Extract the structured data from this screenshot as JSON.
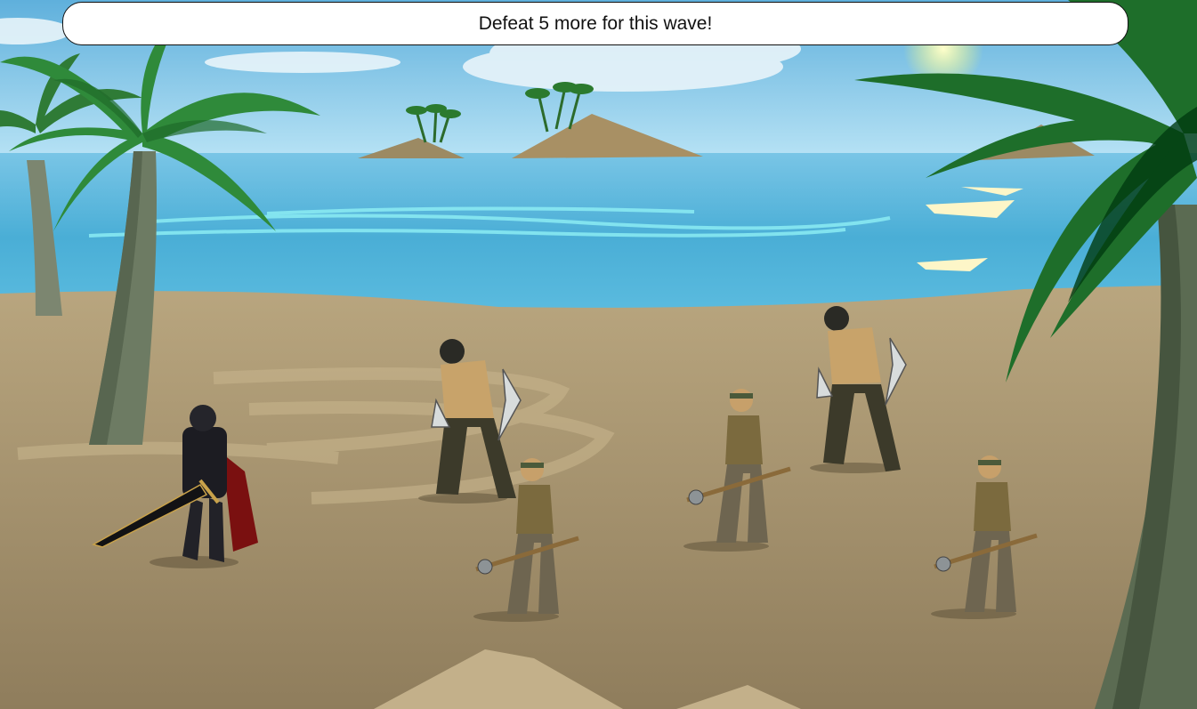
{
  "hud": {
    "wave_message": "Defeat 5 more for this wave!"
  },
  "scene": {
    "location": "beach",
    "colors": {
      "sky": "#8fd0ee",
      "sea": "#4fb3d9",
      "sand": "#a89672",
      "palm_leaf": "#2f8a3a",
      "trunk": "#6b7a5f"
    }
  },
  "characters": {
    "player": {
      "type": "dark-armored-knight",
      "weapon": "greatsword"
    },
    "enemies": [
      {
        "type": "masked-bandit-brawler",
        "weapon": "axe-blade"
      },
      {
        "type": "masked-bandit-brawler",
        "weapon": "axe-blade"
      },
      {
        "type": "bandana-mercenary",
        "weapon": "spiked-mace"
      },
      {
        "type": "bandana-mercenary",
        "weapon": "spiked-mace"
      },
      {
        "type": "bandana-mercenary",
        "weapon": "spiked-mace"
      }
    ]
  }
}
